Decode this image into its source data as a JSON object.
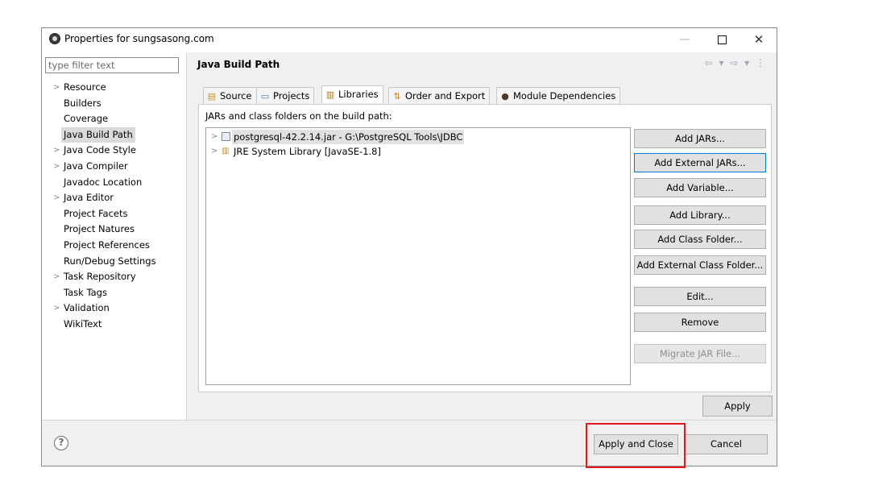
{
  "window": {
    "title": "Properties for sungsasong.com",
    "minimize": "—",
    "close": "✕"
  },
  "filter": {
    "placeholder": "type filter text"
  },
  "tree": [
    {
      "label": "Resource",
      "expandable": true
    },
    {
      "label": "Builders",
      "expandable": false
    },
    {
      "label": "Coverage",
      "expandable": false
    },
    {
      "label": "Java Build Path",
      "expandable": false,
      "selected": true
    },
    {
      "label": "Java Code Style",
      "expandable": true
    },
    {
      "label": "Java Compiler",
      "expandable": true
    },
    {
      "label": "Javadoc Location",
      "expandable": false
    },
    {
      "label": "Java Editor",
      "expandable": true
    },
    {
      "label": "Project Facets",
      "expandable": false
    },
    {
      "label": "Project Natures",
      "expandable": false
    },
    {
      "label": "Project References",
      "expandable": false
    },
    {
      "label": "Run/Debug Settings",
      "expandable": false
    },
    {
      "label": "Task Repository",
      "expandable": true
    },
    {
      "label": "Task Tags",
      "expandable": false
    },
    {
      "label": "Validation",
      "expandable": true
    },
    {
      "label": "WikiText",
      "expandable": false
    }
  ],
  "header": {
    "title": "Java Build Path",
    "nav_icons": "⇦ ▾ ⇨ ▾ ⋮"
  },
  "tabs": [
    {
      "label": "Source",
      "icon": "source-folder-icon",
      "glyph": "▤"
    },
    {
      "label": "Projects",
      "icon": "projects-icon",
      "glyph": "▭"
    },
    {
      "label": "Libraries",
      "icon": "libraries-icon",
      "glyph": "▥",
      "active": true
    },
    {
      "label": "Order and Export",
      "icon": "order-export-icon",
      "glyph": "⇅"
    },
    {
      "label": "Module Dependencies",
      "icon": "module-icon",
      "glyph": "●"
    }
  ],
  "libraries": {
    "caption": "JARs and class folders on the build path:",
    "items": [
      {
        "label": "postgresql-42.2.14.jar - G:\\PostgreSQL Tools\\JDBC",
        "icon": "jar-icon",
        "selected": true
      },
      {
        "label": "JRE System Library [JavaSE-1.8]",
        "icon": "jre-library-icon"
      }
    ]
  },
  "side_buttons": [
    {
      "label": "Add JARs...",
      "name": "add-jars-button"
    },
    {
      "label": "Add External JARs...",
      "name": "add-external-jars-button",
      "focused": true
    },
    {
      "label": "Add Variable...",
      "name": "add-variable-button"
    },
    {
      "label": "Add Library...",
      "name": "add-library-button"
    },
    {
      "label": "Add Class Folder...",
      "name": "add-class-folder-button"
    },
    {
      "label": "Add External Class Folder...",
      "name": "add-external-class-folder-button"
    },
    {
      "label": "Edit...",
      "name": "edit-button"
    },
    {
      "label": "Remove",
      "name": "remove-button"
    },
    {
      "label": "Migrate JAR File...",
      "name": "migrate-jar-file-button",
      "disabled": true
    }
  ],
  "buttons": {
    "apply": "Apply",
    "apply_and_close": "Apply and Close",
    "cancel": "Cancel",
    "help": "?"
  },
  "colors": {
    "highlight": "#e8151a",
    "focus": "#0078d7",
    "dialog_bg": "#f0f0f0"
  }
}
